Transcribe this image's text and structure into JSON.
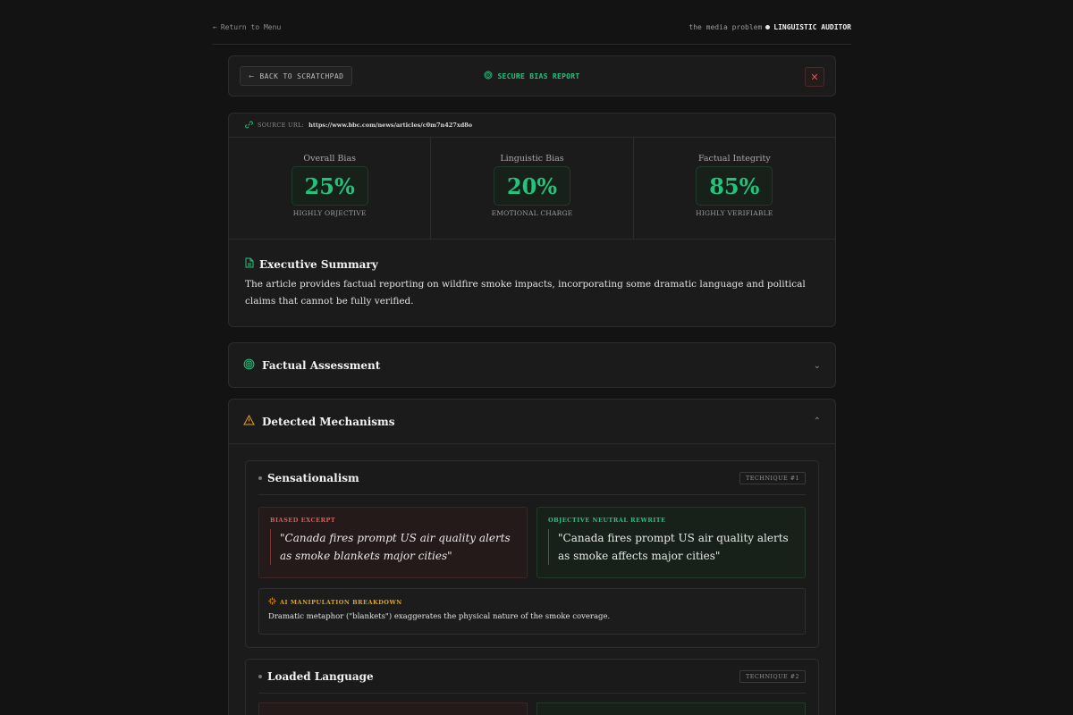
{
  "topbar": {
    "return_label": "Return to Menu",
    "brand_prefix": "the media problem",
    "brand_name": "LINGUISTIC AUDITOR"
  },
  "header": {
    "back_label": "BACK TO SCRATCHPAD",
    "title": "SECURE BIAS REPORT",
    "close_label": "✕"
  },
  "source": {
    "label": "SOURCE URL:",
    "url": "https://www.bbc.com/news/articles/c0m7n427xd8o"
  },
  "metrics": [
    {
      "label": "Overall Bias",
      "value": "25%",
      "sub": "HIGHLY OBJECTIVE"
    },
    {
      "label": "Linguistic Bias",
      "value": "20%",
      "sub": "EMOTIONAL CHARGE"
    },
    {
      "label": "Factual Integrity",
      "value": "85%",
      "sub": "HIGHLY VERIFIABLE"
    }
  ],
  "summary": {
    "title": "Executive Summary",
    "text": "The article provides factual reporting on wildfire smoke impacts, incorporating some dramatic language and political claims that cannot be fully verified."
  },
  "sections": {
    "factual_title": "Factual Assessment",
    "mechanisms_title": "Detected Mechanisms"
  },
  "techniques": [
    {
      "name": "Sensationalism",
      "tag": "TECHNIQUE #1",
      "biased_label": "BIASED EXCERPT",
      "biased_text": "\"Canada fires prompt US air quality alerts as smoke blankets major cities\"",
      "neutral_label": "OBJECTIVE NEUTRAL REWRITE",
      "neutral_text": "\"Canada fires prompt US air quality alerts as smoke affects major cities\"",
      "breakdown_label": "AI MANIPULATION BREAKDOWN",
      "breakdown_text": "Dramatic metaphor (\"blankets\") exaggerates the physical nature of the smoke coverage."
    },
    {
      "name": "Loaded Language",
      "tag": "TECHNIQUE #2"
    }
  ],
  "colors": {
    "accent_green": "#22c47c",
    "danger_red": "#e05a5a",
    "warning_amber": "#e3a21a",
    "background": "#131313"
  },
  "icons": {
    "return": "arrow-left-icon",
    "back": "arrow-left-icon",
    "title": "fingerprint-icon",
    "close": "close-icon",
    "source": "link-icon",
    "summary": "document-icon",
    "factual": "fingerprint-icon",
    "mechanisms": "warning-icon",
    "breakdown": "sparkle-icon"
  }
}
